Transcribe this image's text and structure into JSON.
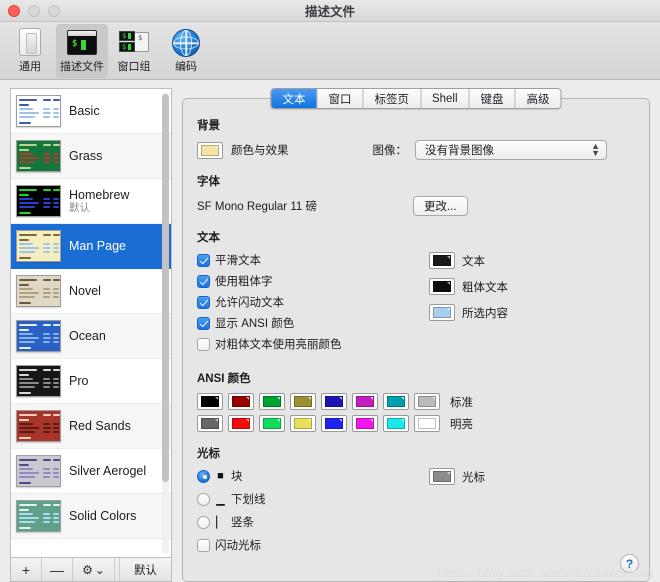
{
  "window": {
    "title": "描述文件",
    "traffic_lights": [
      "close",
      "minimize",
      "maximize"
    ]
  },
  "toolbar": {
    "items": [
      {
        "label": "通用",
        "icon": "general-icon",
        "selected": false
      },
      {
        "label": "描述文件",
        "icon": "profiles-terminal-icon",
        "selected": true
      },
      {
        "label": "窗口组",
        "icon": "window-groups-icon",
        "selected": false
      },
      {
        "label": "编码",
        "icon": "globe-icon",
        "selected": false
      }
    ]
  },
  "sidebar": {
    "profiles": [
      {
        "name": "Basic",
        "sub": "",
        "selected": false,
        "bg": "#ffffff",
        "fg": "#3b5ca8",
        "accent": "#9fc4ea"
      },
      {
        "name": "Grass",
        "sub": "",
        "selected": false,
        "bg": "#13773d",
        "fg": "#b8d98a",
        "accent": "#b23a2f"
      },
      {
        "name": "Homebrew",
        "sub": "默认",
        "selected": false,
        "bg": "#000000",
        "fg": "#23d523",
        "accent": "#2a3fd0"
      },
      {
        "name": "Man Page",
        "sub": "",
        "selected": true,
        "bg": "#f7eec0",
        "fg": "#7a6a3a",
        "accent": "#9fc4ea"
      },
      {
        "name": "Novel",
        "sub": "",
        "selected": false,
        "bg": "#dfd8c4",
        "fg": "#6b5b46",
        "accent": "#b0a184"
      },
      {
        "name": "Ocean",
        "sub": "",
        "selected": false,
        "bg": "#2a5fc4",
        "fg": "#e6eefc",
        "accent": "#86b2ef"
      },
      {
        "name": "Pro",
        "sub": "",
        "selected": false,
        "bg": "#161616",
        "fg": "#d8d8d8",
        "accent": "#8a8a8a"
      },
      {
        "name": "Red Sands",
        "sub": "",
        "selected": false,
        "bg": "#a8352a",
        "fg": "#f0cfc2",
        "accent": "#5b1a13"
      },
      {
        "name": "Silver Aerogel",
        "sub": "",
        "selected": false,
        "bg": "#c9c9cf",
        "fg": "#4b4b8a",
        "accent": "#8e8ec4"
      },
      {
        "name": "Solid Colors",
        "sub": "",
        "selected": false,
        "bg": "#5fa089",
        "fg": "#e4f2ec",
        "accent": "#a8dcee"
      }
    ],
    "toolbar": {
      "add_label": "+",
      "remove_label": "—",
      "gear_label": "⚙",
      "gear_chevron": "⌄",
      "default_label": "默认"
    }
  },
  "panel": {
    "tabs": [
      {
        "label": "文本",
        "active": true
      },
      {
        "label": "窗口",
        "active": false
      },
      {
        "label": "标签页",
        "active": false
      },
      {
        "label": "Shell",
        "active": false
      },
      {
        "label": "键盘",
        "active": false
      },
      {
        "label": "高级",
        "active": false
      }
    ],
    "background": {
      "title": "背景",
      "color_swatch": "#f5e3a6",
      "color_label": "颜色与效果",
      "image_field_label": "图像：",
      "image_value": "没有背景图像",
      "arrows_glyph": "⌃⌄"
    },
    "font": {
      "title": "字体",
      "value": "SF Mono Regular 11 磅",
      "change_button": "更改..."
    },
    "text": {
      "title": "文本",
      "checkboxes": [
        {
          "label": "平滑文本",
          "checked": true
        },
        {
          "label": "使用粗体字",
          "checked": true
        },
        {
          "label": "允许闪动文本",
          "checked": true
        },
        {
          "label": "显示 ANSI 颜色",
          "checked": true
        },
        {
          "label": "对粗体文本使用亮丽颜色",
          "checked": false
        }
      ],
      "swatches": [
        {
          "label": "文本",
          "color": "#1a1a1a"
        },
        {
          "label": "粗体文本",
          "color": "#0d0d0d"
        },
        {
          "label": "所选内容",
          "color": "#a8cdee"
        }
      ]
    },
    "ansi": {
      "title": "ANSI 颜色",
      "rows": [
        {
          "label": "标准",
          "colors": [
            "#000000",
            "#990000",
            "#00a233",
            "#9a9033",
            "#1e14b5",
            "#c21ec2",
            "#00a0b0",
            "#bababa"
          ]
        },
        {
          "label": "明亮",
          "colors": [
            "#666666",
            "#f40c0c",
            "#10dd5e",
            "#eade5d",
            "#2222ef",
            "#ef19ef",
            "#19e9e9",
            "#ffffff"
          ]
        }
      ]
    },
    "cursor": {
      "title": "光标",
      "options": [
        {
          "label": "块",
          "glyph": "■",
          "selected": true
        },
        {
          "label": "下划线",
          "glyph": "▁",
          "selected": false
        },
        {
          "label": "竖条",
          "glyph": "▏",
          "selected": false
        }
      ],
      "blink": {
        "label": "闪动光标",
        "checked": false
      },
      "swatch": {
        "label": "光标",
        "color": "#8c8c8c"
      }
    },
    "help_label": "?"
  },
  "watermark": "https://blog.csdn.net/sheqianweilong"
}
